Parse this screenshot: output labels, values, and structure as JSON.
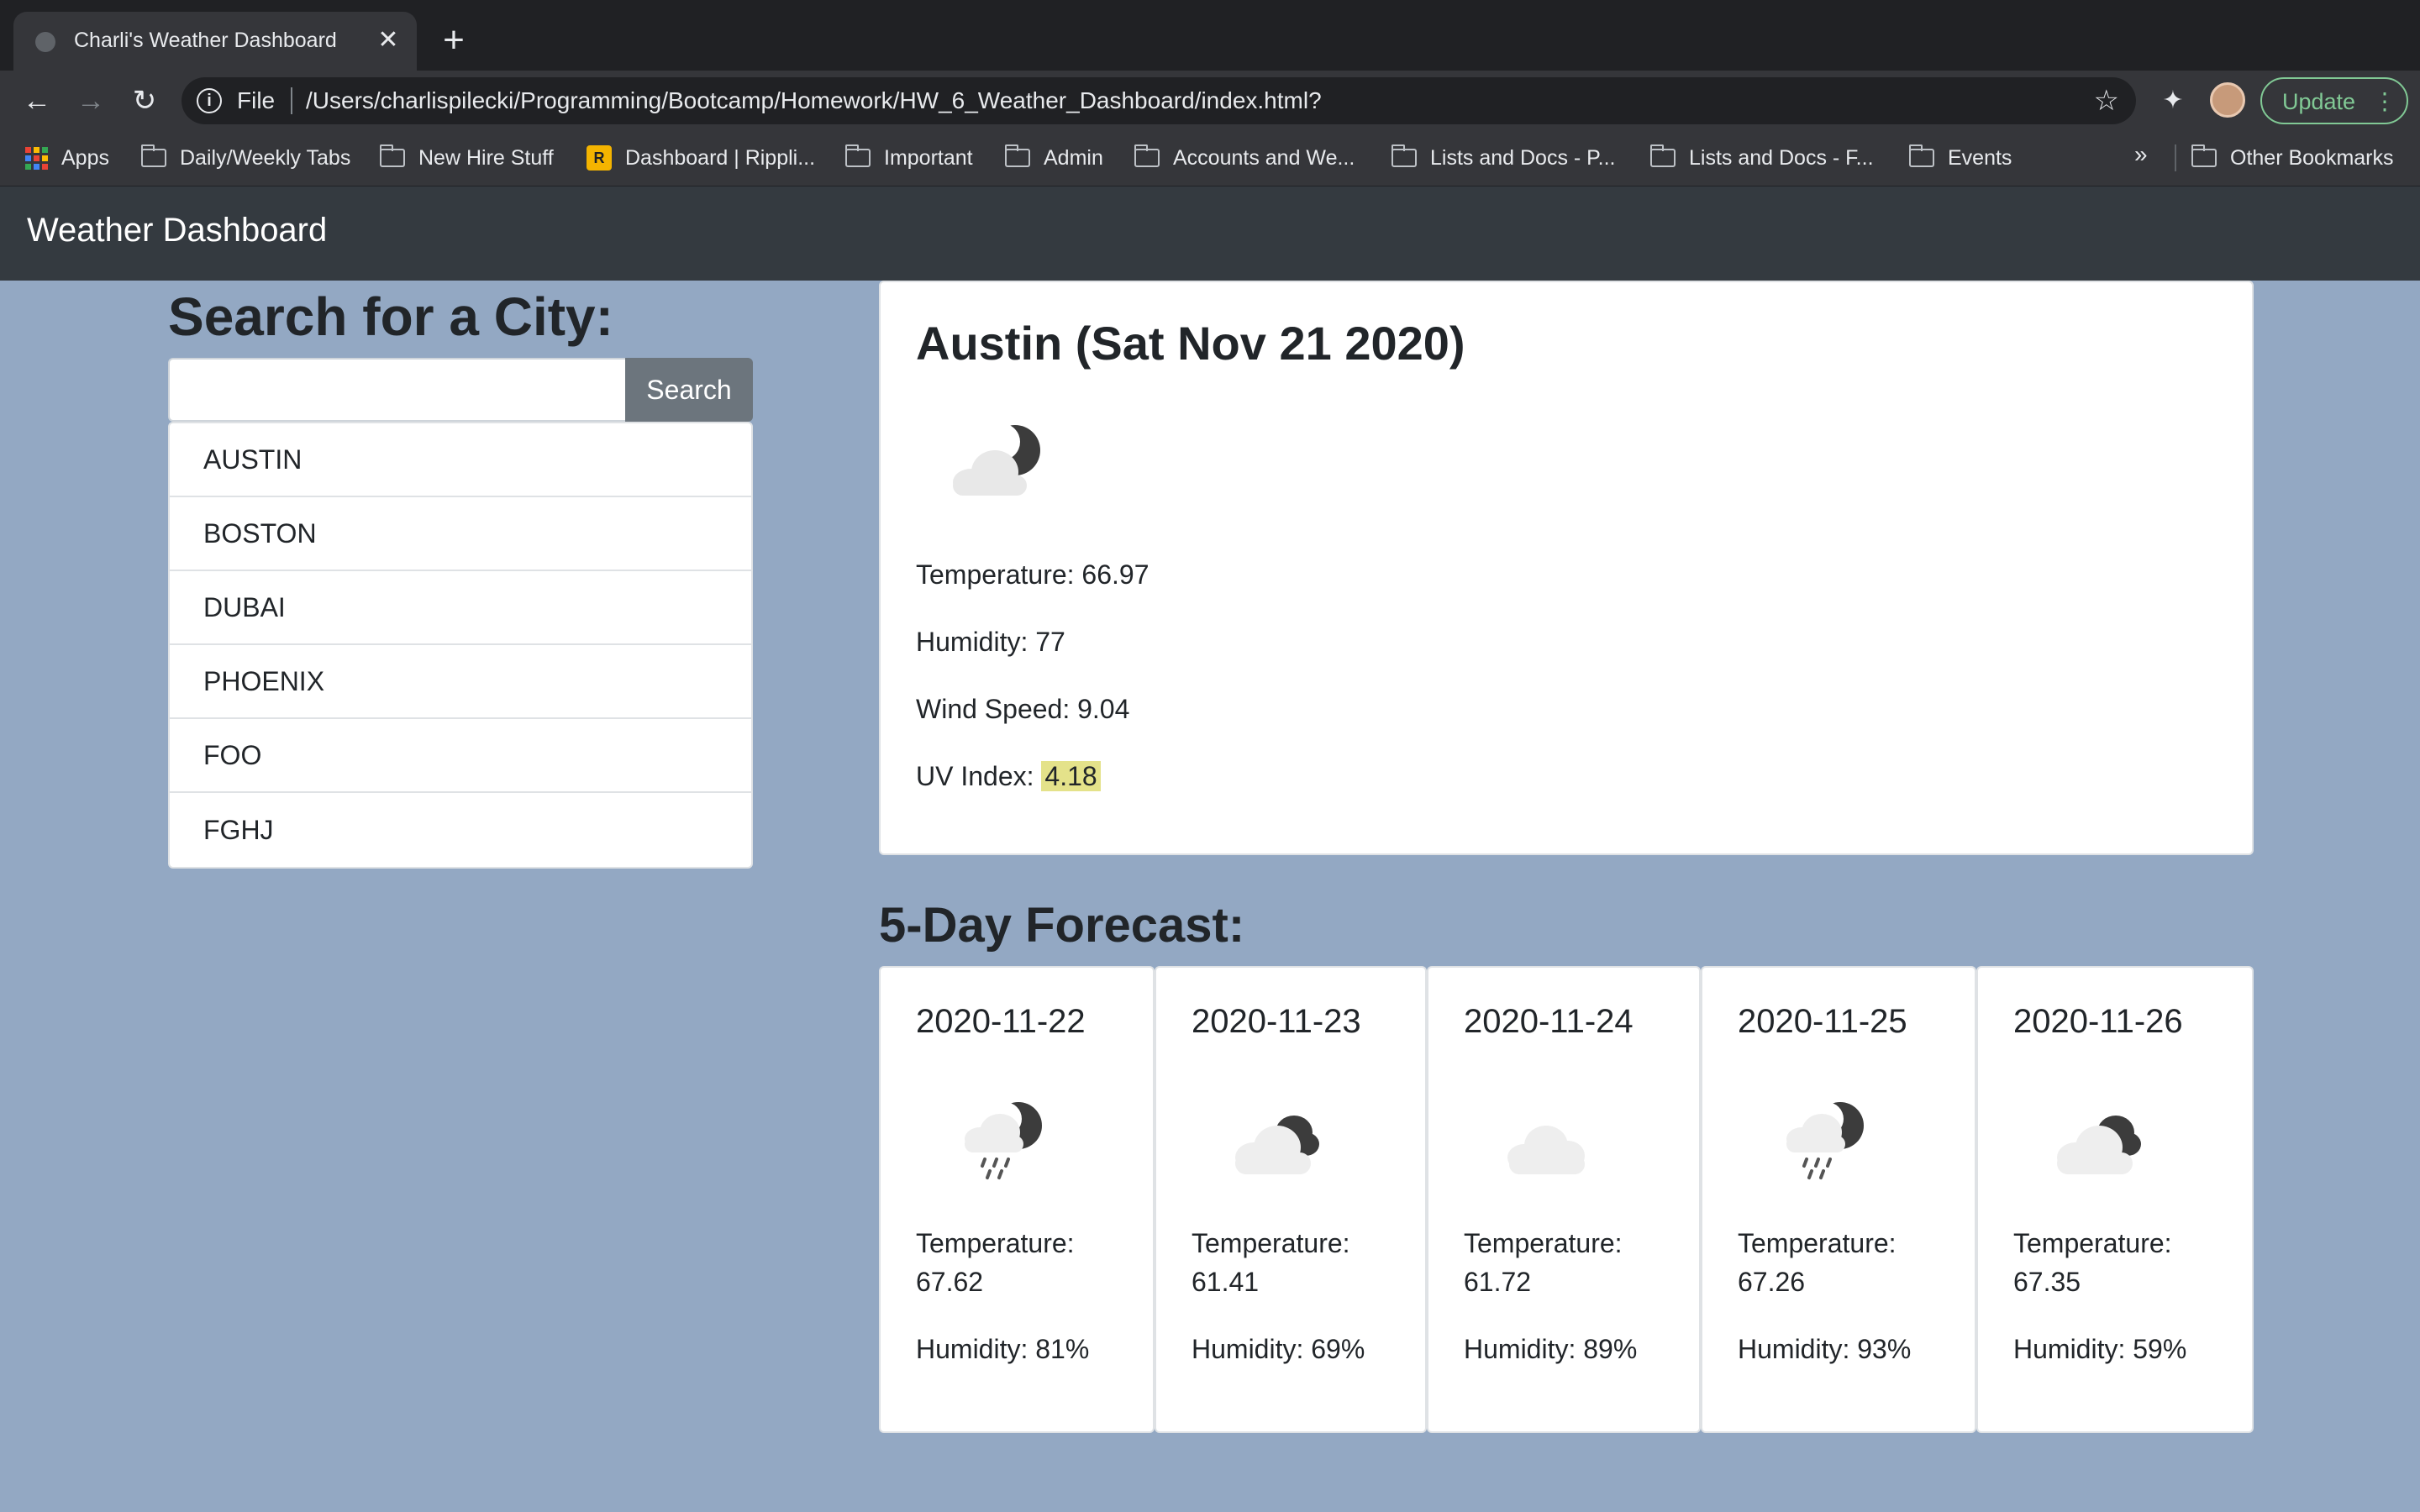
{
  "browser": {
    "tab_title": "Charli's Weather Dashboard",
    "tab_close": "✕",
    "new_tab": "+",
    "url_scheme": "File",
    "url": "/Users/charlispilecki/Programming/Bootcamp/Homework/HW_6_Weather_Dashboard/index.html?",
    "update_label": "Update",
    "bookmarks": [
      {
        "label": "Apps",
        "icon": "apps-grid-icon"
      },
      {
        "label": "Daily/Weekly Tabs",
        "icon": "folder-icon"
      },
      {
        "label": "New Hire Stuff",
        "icon": "folder-icon"
      },
      {
        "label": "Dashboard | Rippli...",
        "icon": "ripple-logo-icon"
      },
      {
        "label": "Important",
        "icon": "folder-icon"
      },
      {
        "label": "Admin",
        "icon": "folder-icon"
      },
      {
        "label": "Accounts and We...",
        "icon": "folder-icon"
      },
      {
        "label": "Lists and Docs - P...",
        "icon": "folder-icon"
      },
      {
        "label": "Lists and Docs - F...",
        "icon": "folder-icon"
      },
      {
        "label": "Events",
        "icon": "folder-icon"
      }
    ],
    "more_bookmarks": "»",
    "other_bookmarks": "Other Bookmarks"
  },
  "navbar": {
    "brand": "Weather Dashboard"
  },
  "search": {
    "title": "Search for a City:",
    "input_value": "",
    "button_label": "Search",
    "history": [
      "AUSTIN",
      "BOSTON",
      "DUBAI",
      "PHOENIX",
      "FOO",
      "FGHJ"
    ]
  },
  "current": {
    "title": "Austin (Sat Nov 21 2020)",
    "icon": "partly-cloudy-night-icon",
    "temperature": "Temperature: 66.97",
    "humidity": "Humidity: 77",
    "wind_speed": "Wind Speed: 9.04",
    "uv_label": "UV Index: ",
    "uv_value": "4.18",
    "uv_color": "#e4e28a"
  },
  "forecast": {
    "title": "5-Day Forecast:",
    "temp_label": "Temperature:",
    "days": [
      {
        "date": "2020-11-22",
        "temp": "67.62",
        "humidity": "Humidity: 81%",
        "icon": "rain-night-icon"
      },
      {
        "date": "2020-11-23",
        "temp": "61.41",
        "humidity": "Humidity: 69%",
        "icon": "broken-clouds-icon"
      },
      {
        "date": "2020-11-24",
        "temp": "61.72",
        "humidity": "Humidity: 89%",
        "icon": "cloud-icon"
      },
      {
        "date": "2020-11-25",
        "temp": "67.26",
        "humidity": "Humidity: 93%",
        "icon": "rain-night-icon"
      },
      {
        "date": "2020-11-26",
        "temp": "67.35",
        "humidity": "Humidity: 59%",
        "icon": "broken-clouds-icon"
      }
    ]
  },
  "colors": {
    "page_bg": "#93a8c3",
    "navbar_bg": "#343a40",
    "search_button": "#6c757d"
  }
}
